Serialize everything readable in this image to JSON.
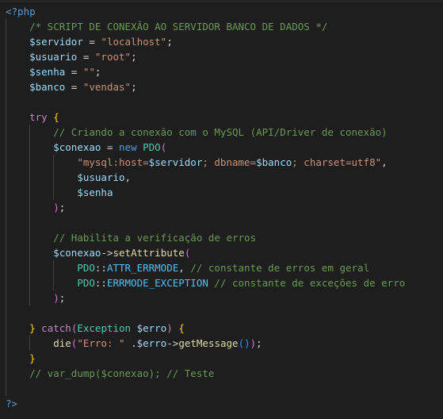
{
  "editor": {
    "language": "php",
    "lines": [
      [
        {
          "t": "<?php",
          "c": "tag"
        }
      ],
      [
        {
          "t": "    ",
          "c": "op"
        },
        {
          "t": "/* SCRIPT DE CONEXÃO AO SERVIDOR BANCO DE DADOS */",
          "c": "com"
        }
      ],
      [
        {
          "t": "    ",
          "c": "op"
        },
        {
          "t": "$servidor",
          "c": "var"
        },
        {
          "t": " = ",
          "c": "op"
        },
        {
          "t": "\"localhost\"",
          "c": "str"
        },
        {
          "t": ";",
          "c": "op"
        }
      ],
      [
        {
          "t": "    ",
          "c": "op"
        },
        {
          "t": "$usuario",
          "c": "var"
        },
        {
          "t": " = ",
          "c": "op"
        },
        {
          "t": "\"root\"",
          "c": "str"
        },
        {
          "t": ";",
          "c": "op"
        }
      ],
      [
        {
          "t": "    ",
          "c": "op"
        },
        {
          "t": "$senha",
          "c": "var"
        },
        {
          "t": " = ",
          "c": "op"
        },
        {
          "t": "\"\"",
          "c": "str"
        },
        {
          "t": ";",
          "c": "op"
        }
      ],
      [
        {
          "t": "    ",
          "c": "op"
        },
        {
          "t": "$banco",
          "c": "var"
        },
        {
          "t": " = ",
          "c": "op"
        },
        {
          "t": "\"vendas\"",
          "c": "str"
        },
        {
          "t": ";",
          "c": "op"
        }
      ],
      [],
      [
        {
          "t": "    ",
          "c": "op"
        },
        {
          "t": "try",
          "c": "kw"
        },
        {
          "t": " ",
          "c": "op"
        },
        {
          "t": "{",
          "c": "br1"
        }
      ],
      [
        {
          "t": "        ",
          "c": "op"
        },
        {
          "t": "// Criando a conexão com o MySQL (API/Driver de conexão)",
          "c": "com"
        }
      ],
      [
        {
          "t": "        ",
          "c": "op"
        },
        {
          "t": "$conexao",
          "c": "var"
        },
        {
          "t": " = ",
          "c": "op"
        },
        {
          "t": "new",
          "c": "tag"
        },
        {
          "t": " ",
          "c": "op"
        },
        {
          "t": "PDO",
          "c": "cls"
        },
        {
          "t": "(",
          "c": "br2"
        }
      ],
      [
        {
          "t": "            ",
          "c": "op"
        },
        {
          "t": "\"mysql:host=",
          "c": "str"
        },
        {
          "t": "$servidor",
          "c": "var"
        },
        {
          "t": "; dbname=",
          "c": "str"
        },
        {
          "t": "$banco",
          "c": "var"
        },
        {
          "t": "; charset=utf8\"",
          "c": "str"
        },
        {
          "t": ",",
          "c": "op"
        }
      ],
      [
        {
          "t": "            ",
          "c": "op"
        },
        {
          "t": "$usuario",
          "c": "var"
        },
        {
          "t": ",",
          "c": "op"
        }
      ],
      [
        {
          "t": "            ",
          "c": "op"
        },
        {
          "t": "$senha",
          "c": "var"
        }
      ],
      [
        {
          "t": "        ",
          "c": "op"
        },
        {
          "t": ")",
          "c": "br2"
        },
        {
          "t": ";",
          "c": "op"
        }
      ],
      [],
      [
        {
          "t": "        ",
          "c": "op"
        },
        {
          "t": "// Habilita a verificação de erros",
          "c": "com"
        }
      ],
      [
        {
          "t": "        ",
          "c": "op"
        },
        {
          "t": "$conexao",
          "c": "var"
        },
        {
          "t": "->",
          "c": "op"
        },
        {
          "t": "setAttribute",
          "c": "fn"
        },
        {
          "t": "(",
          "c": "br2"
        }
      ],
      [
        {
          "t": "            ",
          "c": "op"
        },
        {
          "t": "PDO",
          "c": "cls"
        },
        {
          "t": "::",
          "c": "op"
        },
        {
          "t": "ATTR_ERRMODE",
          "c": "const"
        },
        {
          "t": ", ",
          "c": "op"
        },
        {
          "t": "// constante de erros em geral",
          "c": "com"
        }
      ],
      [
        {
          "t": "            ",
          "c": "op"
        },
        {
          "t": "PDO",
          "c": "cls"
        },
        {
          "t": "::",
          "c": "op"
        },
        {
          "t": "ERRMODE_EXCEPTION",
          "c": "const"
        },
        {
          "t": " ",
          "c": "op"
        },
        {
          "t": "// constante de exceções de erro",
          "c": "com"
        }
      ],
      [
        {
          "t": "        ",
          "c": "op"
        },
        {
          "t": ")",
          "c": "br2"
        },
        {
          "t": ";",
          "c": "op"
        }
      ],
      [],
      [
        {
          "t": "    ",
          "c": "op"
        },
        {
          "t": "}",
          "c": "br1"
        },
        {
          "t": " ",
          "c": "op"
        },
        {
          "t": "catch",
          "c": "kw"
        },
        {
          "t": "(",
          "c": "br2"
        },
        {
          "t": "Exception",
          "c": "cls"
        },
        {
          "t": " ",
          "c": "op"
        },
        {
          "t": "$erro",
          "c": "var"
        },
        {
          "t": ")",
          "c": "br2"
        },
        {
          "t": " ",
          "c": "op"
        },
        {
          "t": "{",
          "c": "br1"
        }
      ],
      [
        {
          "t": "        ",
          "c": "op"
        },
        {
          "t": "die",
          "c": "fn"
        },
        {
          "t": "(",
          "c": "br2"
        },
        {
          "t": "\"Erro: \"",
          "c": "str"
        },
        {
          "t": " .",
          "c": "op"
        },
        {
          "t": "$erro",
          "c": "var"
        },
        {
          "t": "->",
          "c": "op"
        },
        {
          "t": "getMessage",
          "c": "fn"
        },
        {
          "t": "(",
          "c": "br3"
        },
        {
          "t": ")",
          "c": "br3"
        },
        {
          "t": ")",
          "c": "br2"
        },
        {
          "t": ";",
          "c": "op"
        }
      ],
      [
        {
          "t": "    ",
          "c": "op"
        },
        {
          "t": "}",
          "c": "br1"
        }
      ],
      [
        {
          "t": "    ",
          "c": "op"
        },
        {
          "t": "// var_dump($conexao); // Teste",
          "c": "com"
        }
      ],
      [],
      [
        {
          "t": "?>",
          "c": "tag"
        }
      ]
    ]
  }
}
